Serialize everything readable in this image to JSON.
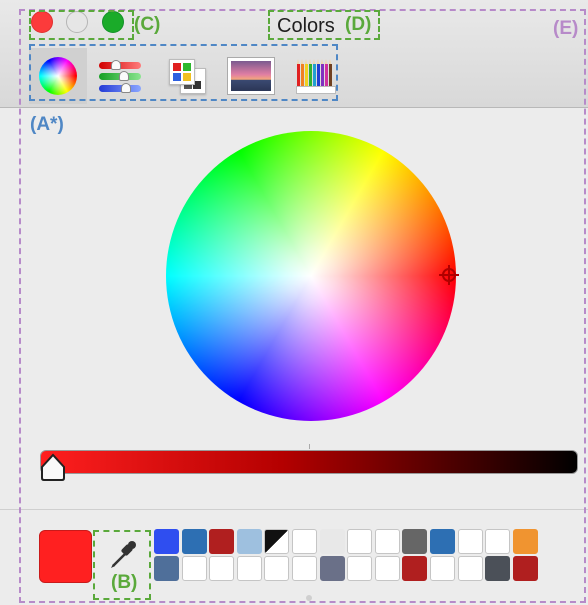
{
  "window": {
    "title": "Colors"
  },
  "toolbar": {
    "tools": [
      {
        "name": "color-wheel",
        "selected": true
      },
      {
        "name": "color-sliders",
        "selected": false
      },
      {
        "name": "color-palettes",
        "selected": false
      },
      {
        "name": "image-palettes",
        "selected": false
      },
      {
        "name": "pencils",
        "selected": false
      }
    ]
  },
  "picker": {
    "current_color": "#ff2020",
    "brightness_level": 0.0
  },
  "swatches": {
    "row1": [
      "#2f4ef0",
      "#2d6fb3",
      "#b01f1f",
      "#9ec0df",
      "diagonal",
      "#ffffff",
      "#e8e8e8",
      "#ffffff",
      "#ffffff",
      "#666666",
      "#2d6fb3",
      "#ffffff",
      "#ffffff",
      "#f09430"
    ],
    "row2": [
      "#4f6f9a",
      "#ffffff",
      "#ffffff",
      "#ffffff",
      "#ffffff",
      "#ffffff",
      "#6a7088",
      "#ffffff",
      "#ffffff",
      "#b01f1f",
      "#ffffff",
      "#ffffff",
      "#4b5058",
      "#b01f1f"
    ]
  },
  "annotations": {
    "a": "(A*)",
    "b": "(B)",
    "c": "(C)",
    "d": "(D)",
    "e": "(E)"
  },
  "colors": {
    "accent_red": "#ff2020",
    "annotation_green": "#5aa93b",
    "annotation_blue": "#4f87c5",
    "annotation_purple": "#b78ac9"
  }
}
